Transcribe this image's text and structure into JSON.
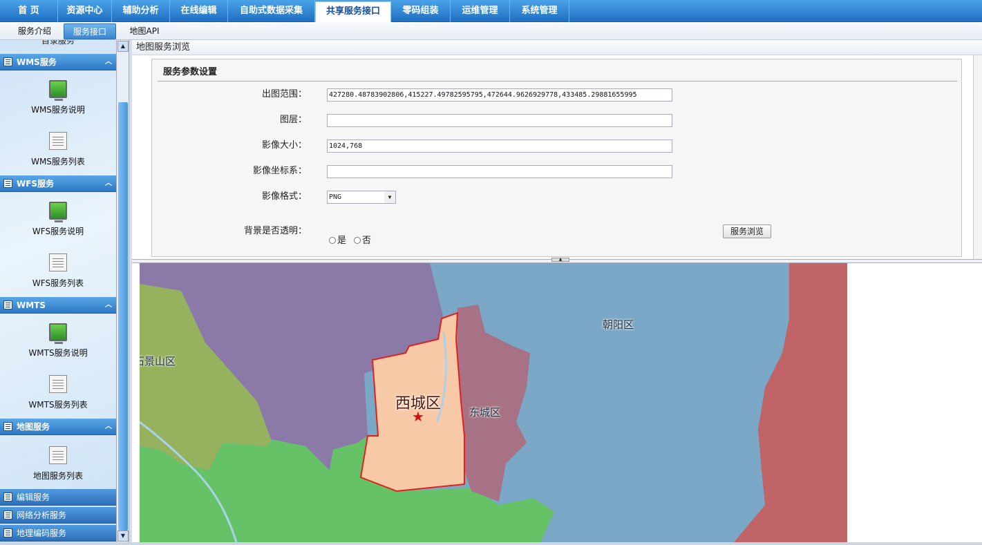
{
  "topnav": {
    "tabs": [
      "首 页",
      "资源中心",
      "辅助分析",
      "在线编辑",
      "自助式数据采集",
      "共享服务接口",
      "零码组装",
      "运维管理",
      "系统管理"
    ],
    "active": "共享服务接口"
  },
  "subtabs": {
    "items": [
      "服务介绍",
      "服务接口",
      "地图API"
    ],
    "active": "服务接口"
  },
  "sidebar": {
    "clipped_label": "目录服务",
    "sections": [
      {
        "title": "WMS服务",
        "items": [
          "WMS服务说明",
          "WMS服务列表"
        ]
      },
      {
        "title": "WFS服务",
        "items": [
          "WFS服务说明",
          "WFS服务列表"
        ]
      },
      {
        "title": "WMTS",
        "items": [
          "WMTS服务说明",
          "WMTS服务列表"
        ]
      },
      {
        "title": "地图服务",
        "items": [
          "地图服务列表"
        ]
      }
    ],
    "collapsed": [
      "编辑服务",
      "网络分析服务",
      "地理编码服务"
    ]
  },
  "main": {
    "title": "地图服务浏览",
    "panel_title": "服务参数设置",
    "fields": {
      "extent_label": "出图范围：",
      "extent_value": "427280.48783902806,415227.49782595795,472644.9626929778,433485.29881655995",
      "layers_label": "图层：",
      "layers_value": "",
      "size_label": "影像大小：",
      "size_value": "1024,768",
      "crs_label": "影像坐标系：",
      "crs_value": "",
      "format_label": "影像格式：",
      "format_value": "PNG",
      "transparent_label": "背景是否透明：",
      "transparent_yes": "是",
      "transparent_no": "否"
    },
    "browse_button": "服务浏览"
  },
  "map": {
    "labels": {
      "chaoyang": "朝阳区",
      "shijingshan": "石景山区",
      "xicheng": "西城区",
      "dongcheng": "东城区"
    },
    "colors": {
      "haidian": "#8b79a8",
      "chaoyang": "#7aa8c6",
      "shijingshan": "#96b25f",
      "fengtai": "#66c266",
      "dongcheng": "#a77285",
      "xicheng": "#f8c9a6",
      "tongzhou": "#c06468"
    }
  }
}
